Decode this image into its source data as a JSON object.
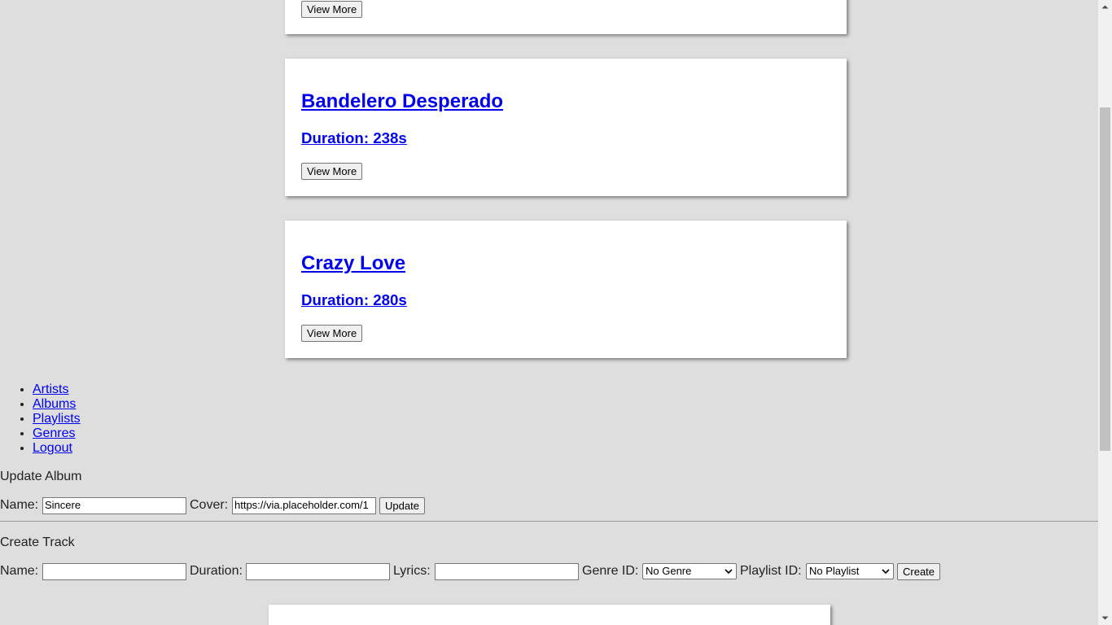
{
  "tracks": [
    {
      "view_more": "View More"
    },
    {
      "name": "Bandelero Desperado",
      "duration": "Duration: 238s",
      "view_more": "View More"
    },
    {
      "name": "Crazy Love",
      "duration": "Duration: 280s",
      "view_more": "View More"
    }
  ],
  "nav": {
    "items": [
      "Artists",
      "Albums",
      "Playlists",
      "Genres",
      "Logout"
    ]
  },
  "update_album": {
    "heading": "Update Album",
    "name_label": "Name:",
    "name_value": "Sincere",
    "cover_label": "Cover:",
    "cover_value": "https://via.placeholder.com/1",
    "submit": "Update"
  },
  "create_track": {
    "heading": "Create Track",
    "name_label": "Name:",
    "name_value": "",
    "duration_label": "Duration:",
    "duration_value": "",
    "lyrics_label": "Lyrics:",
    "lyrics_value": "",
    "genre_label": "Genre ID:",
    "genre_selected": "No Genre",
    "playlist_label": "Playlist ID:",
    "playlist_selected": "No Playlist",
    "submit": "Create"
  }
}
